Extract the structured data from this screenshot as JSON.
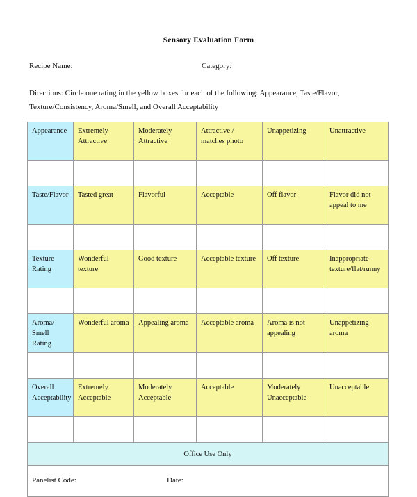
{
  "document": {
    "title": "Sensory Evaluation Form"
  },
  "header": {
    "recipe_name_label": "Recipe Name:",
    "category_label": "Category:",
    "directions": "Directions:  Circle one rating in the yellow boxes for each of the following: Appearance, Taste/Flavor, Texture/Consistency, Aroma/Smell, and Overall Acceptability"
  },
  "colors": {
    "label_cell": "#bff0fb",
    "option_cell": "#f8f79f",
    "office_band": "#d4f5f5",
    "border": "#9a9a9a"
  },
  "table": {
    "rows": [
      {
        "label": "Appearance",
        "options": [
          "Extremely Attractive",
          "Moderately Attractive",
          "Attractive / matches photo",
          "Unappetizing",
          "Unattractive"
        ]
      },
      {
        "label": "Taste/Flavor",
        "options": [
          "Tasted great",
          "Flavorful",
          "Acceptable",
          "Off flavor",
          "Flavor did not appeal to me"
        ]
      },
      {
        "label": "Texture Rating",
        "options": [
          "Wonderful texture",
          "Good texture",
          "Acceptable texture",
          "Off texture",
          "Inappropriate texture/flat/runny"
        ]
      },
      {
        "label": "Aroma/ Smell Rating",
        "options": [
          "Wonderful aroma",
          "Appealing aroma",
          "Acceptable aroma",
          "Aroma is not appealing",
          "Unappetizing aroma"
        ]
      },
      {
        "label": "Overall Acceptability",
        "options": [
          "Extremely Acceptable",
          "Moderately Acceptable",
          "Acceptable",
          "Moderately Unacceptable",
          "Unacceptable"
        ]
      }
    ],
    "office_use_label": "Office Use Only",
    "panelist_code_label": "Panelist Code:",
    "date_label": "Date:"
  }
}
